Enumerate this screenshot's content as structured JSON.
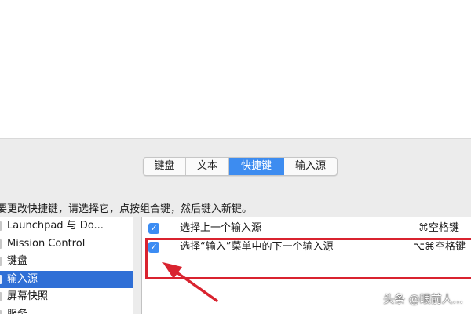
{
  "tabs": [
    {
      "label": "键盘",
      "active": false
    },
    {
      "label": "文本",
      "active": false
    },
    {
      "label": "快捷键",
      "active": true
    },
    {
      "label": "输入源",
      "active": false
    }
  ],
  "instruction": "要更改快捷键，请选择它，点按组合键，然后键入新键。",
  "categories": [
    {
      "label": "Launchpad 与 Do...",
      "selected": false
    },
    {
      "label": "Mission Control",
      "selected": false
    },
    {
      "label": "键盘",
      "selected": false
    },
    {
      "label": "输入源",
      "selected": true
    },
    {
      "label": "屏幕快照",
      "selected": false
    },
    {
      "label": "服务",
      "selected": false
    }
  ],
  "shortcuts": [
    {
      "checked": true,
      "label": "选择上一个输入源",
      "keys": "⌘空格键"
    },
    {
      "checked": true,
      "label": "选择“输入”菜单中的下一个输入源",
      "keys": "⌥⌘空格键"
    }
  ],
  "annotation_color": "#d9232f",
  "accent_color": "#3d8cf0",
  "watermark": "头条 @眼前人..."
}
